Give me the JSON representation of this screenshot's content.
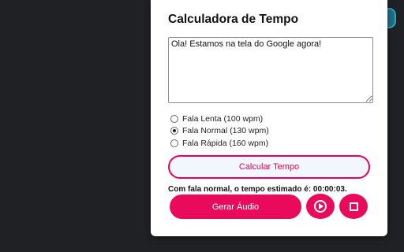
{
  "popup": {
    "title": "Calculadora de Tempo",
    "textarea_value": "Ola! Estamos na tela do Google agora!",
    "speed_options": [
      {
        "label": "Fala Lenta (100 wpm)",
        "checked": false
      },
      {
        "label": "Fala Normal (130 wpm)",
        "checked": true
      },
      {
        "label": "Fala Rápida (160 wpm)",
        "checked": false
      }
    ],
    "calculate_label": "Calcular Tempo",
    "result_text": "Com fala normal, o tempo estimado é: 00:00:03.",
    "generate_audio_label": "Gerar Áudio",
    "play_icon": "play-circle-icon",
    "stop_icon": "stop-icon"
  },
  "colors": {
    "accent": "#ea0a5c",
    "background": "#202124",
    "button_light_bg": "#f2f6fd"
  }
}
